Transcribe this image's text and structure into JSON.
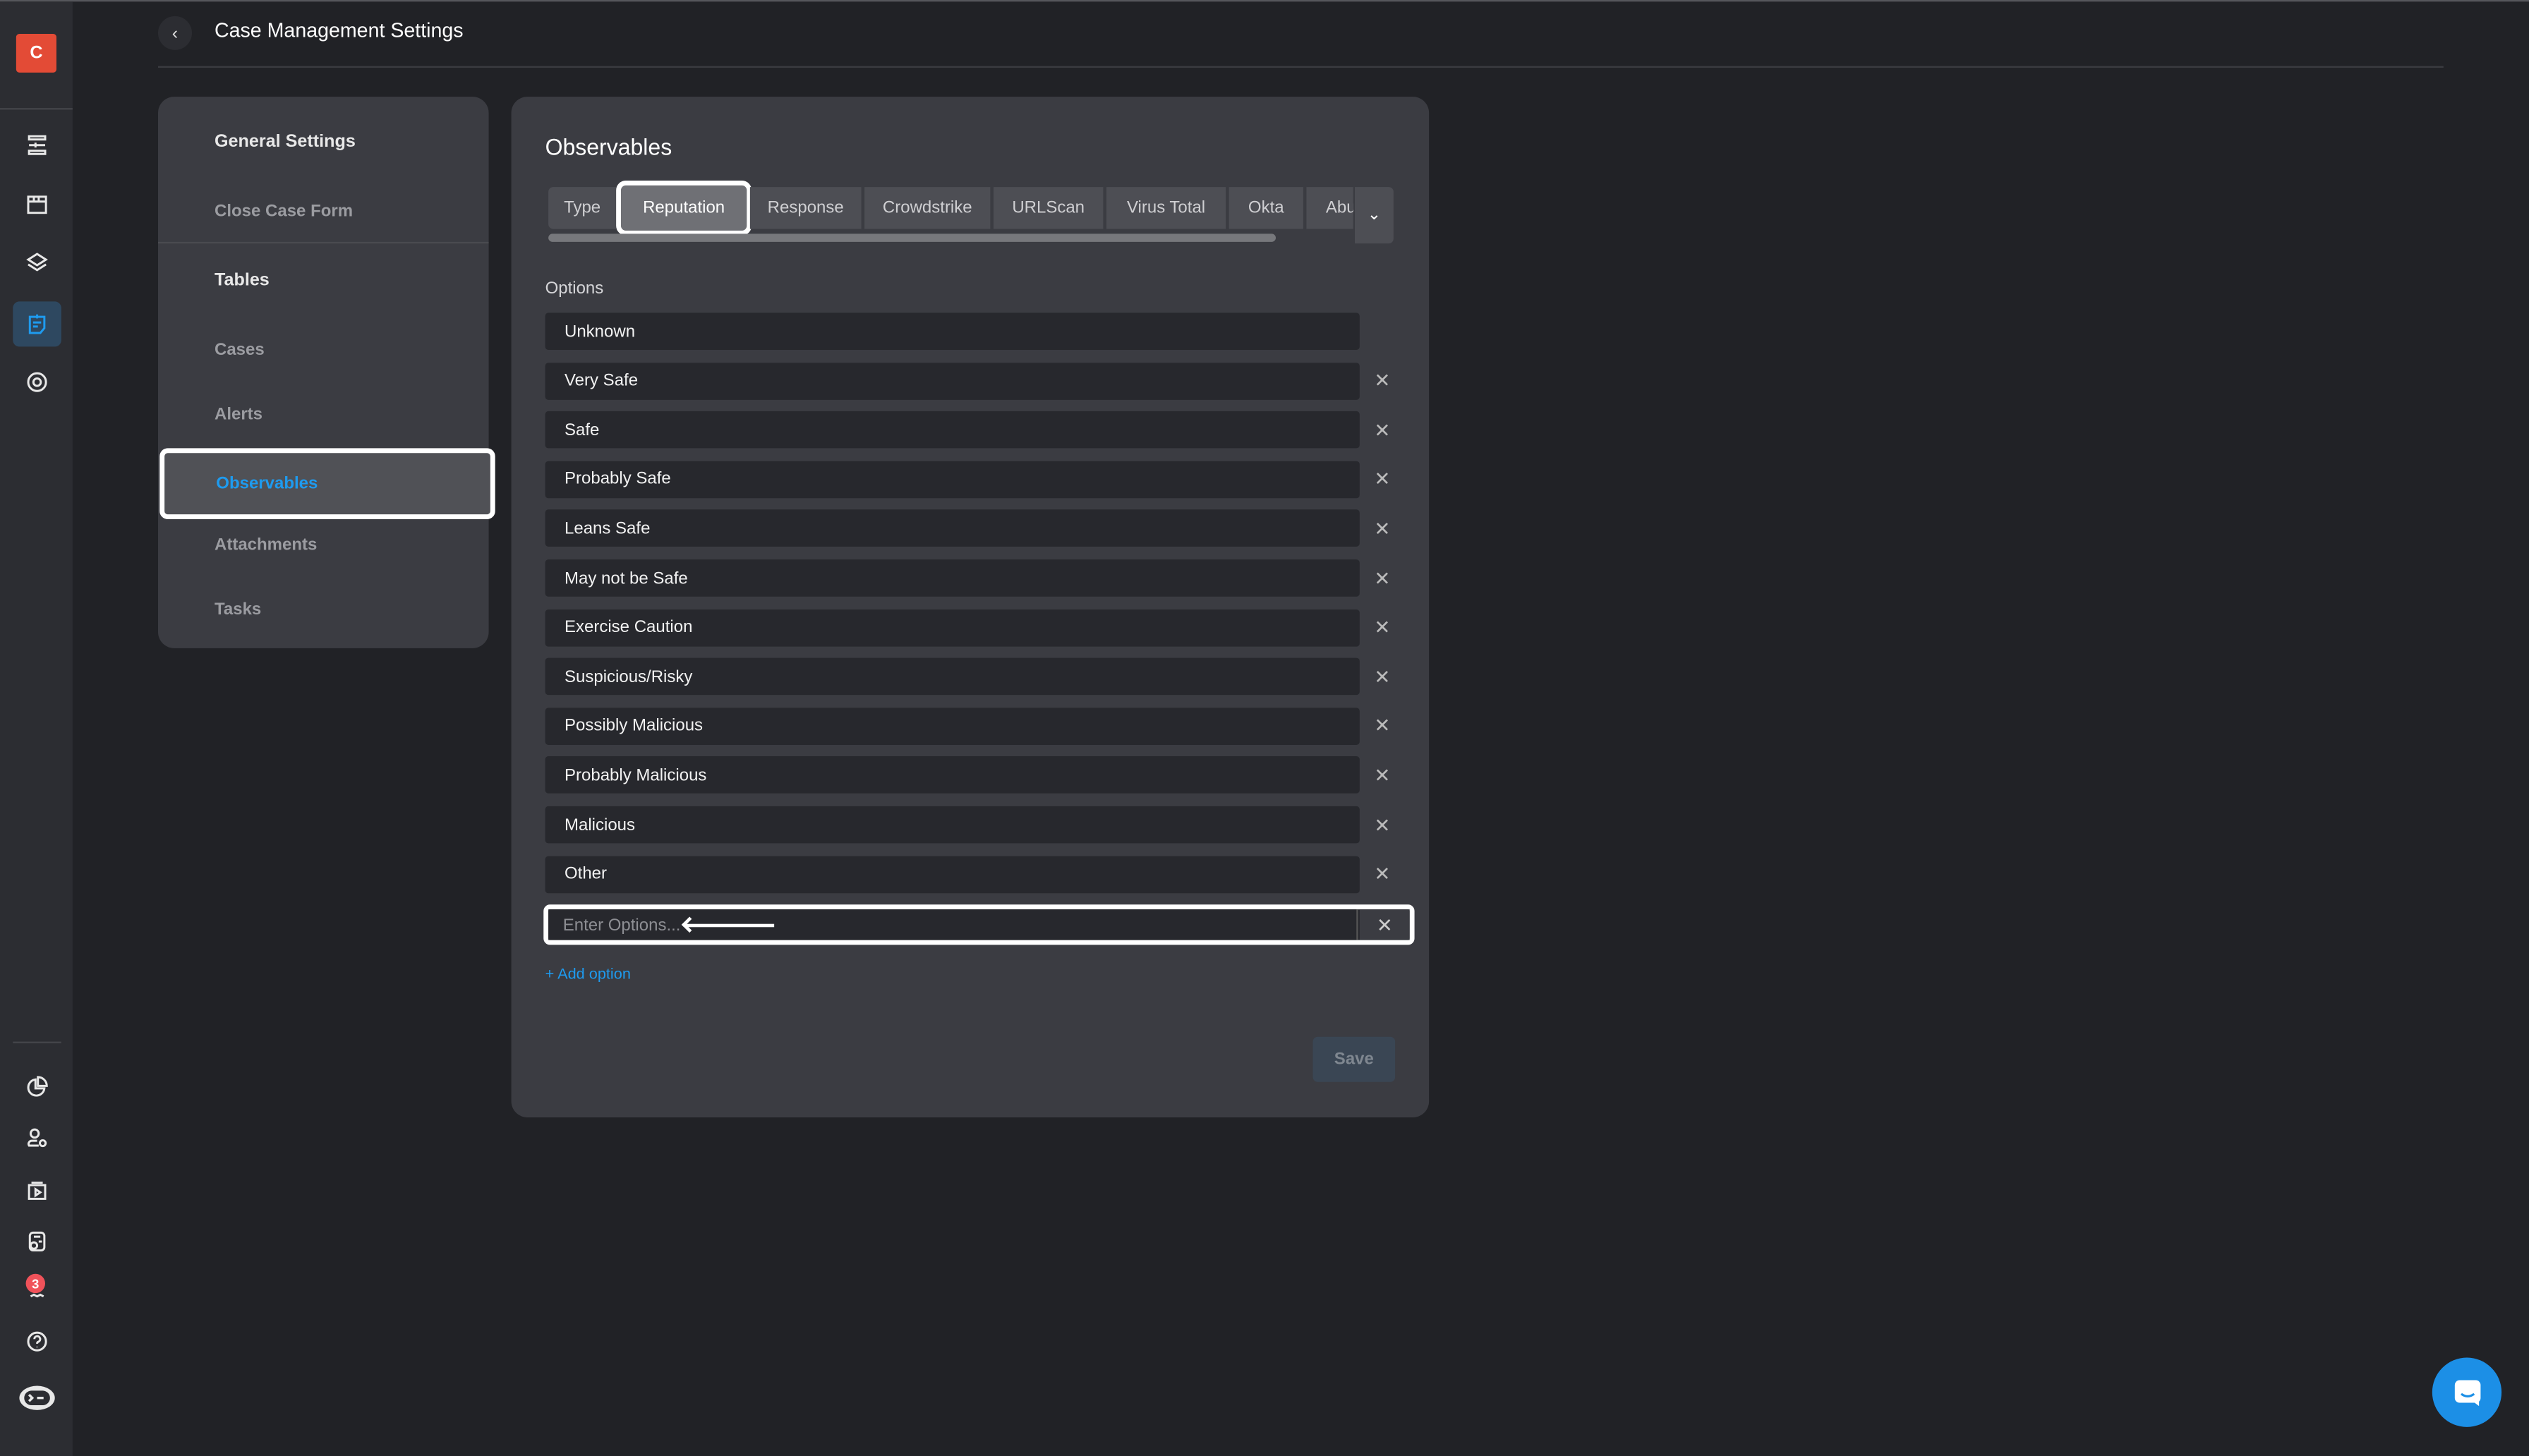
{
  "nav": {
    "logo": "C",
    "badge_count": "3",
    "top_icons": [
      "dashboard-sliders-icon",
      "window-icon",
      "layers-icon",
      "case-notes-icon",
      "settings-icon"
    ],
    "bottom_icons": [
      "pie-chart-icon",
      "user-settings-icon",
      "playbook-icon",
      "report-check-icon",
      "notifications-icon",
      "help-icon",
      "terminal-bot-icon"
    ]
  },
  "header": {
    "title": "Case Management Settings"
  },
  "settings_menu": {
    "items": [
      {
        "label": "General Settings",
        "type": "heading"
      },
      {
        "label": "Close Case Form",
        "type": "item"
      },
      {
        "label": "Tables",
        "type": "heading"
      },
      {
        "label": "Cases",
        "type": "item"
      },
      {
        "label": "Alerts",
        "type": "item"
      },
      {
        "label": "Observables",
        "type": "item",
        "selected": true
      },
      {
        "label": "Attachments",
        "type": "item"
      },
      {
        "label": "Tasks",
        "type": "item"
      }
    ]
  },
  "main": {
    "title": "Observables",
    "tabs": [
      "Type",
      "Reputation",
      "Response",
      "Crowdstrike",
      "URLScan",
      "Virus Total",
      "Okta",
      "Abu"
    ],
    "active_tab": "Reputation",
    "options_label": "Options",
    "options": [
      "Unknown",
      "Very Safe",
      "Safe",
      "Probably Safe",
      "Leans Safe",
      "May not be Safe",
      "Exercise Caution",
      "Suspicious/Risky",
      "Possibly Malicious",
      "Probably Malicious",
      "Malicious",
      "Other"
    ],
    "new_option_placeholder": "Enter Options...",
    "add_option": "+ Add option",
    "save": "Save"
  },
  "colors": {
    "accent": "#1e9bef",
    "logo": "#e34b36",
    "badge": "#f0525a"
  }
}
